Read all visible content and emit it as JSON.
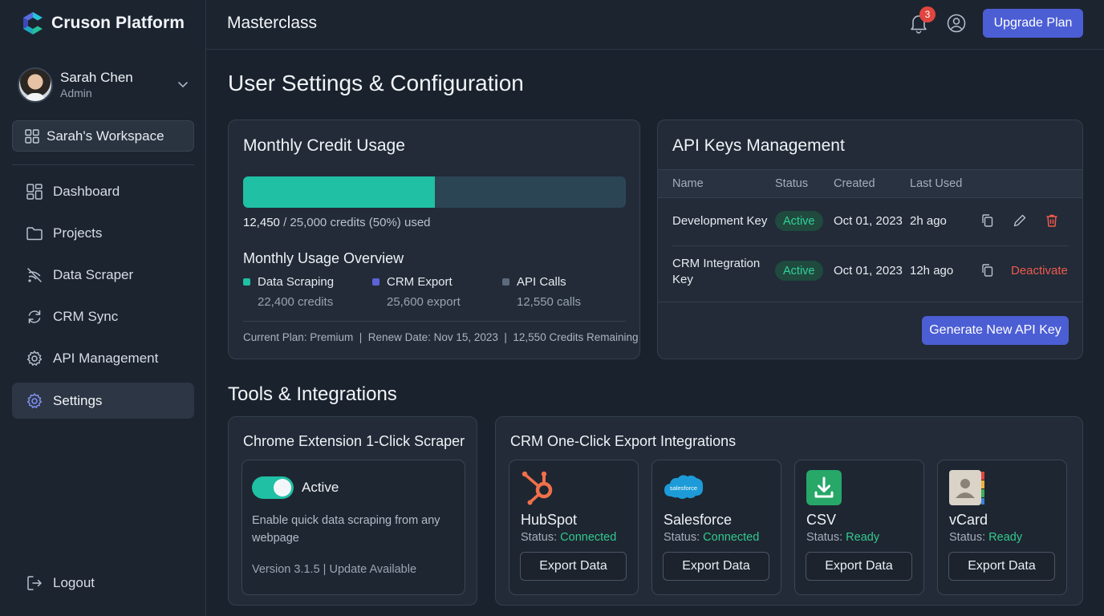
{
  "brand": {
    "name": "Cruson Platform"
  },
  "user": {
    "name": "Sarah Chen",
    "role": "Admin"
  },
  "workspace": {
    "label": "Sarah's Workspace"
  },
  "nav": {
    "items": [
      {
        "label": "Dashboard",
        "icon": "dashboard-icon"
      },
      {
        "label": "Projects",
        "icon": "folder-icon"
      },
      {
        "label": "Data Scraper",
        "icon": "data-scraper-icon"
      },
      {
        "label": "CRM Sync",
        "icon": "sync-icon"
      },
      {
        "label": "API Management",
        "icon": "gear-icon"
      },
      {
        "label": "Settings",
        "icon": "settings-icon",
        "active": true
      }
    ],
    "logout": "Logout"
  },
  "topbar": {
    "title": "Masterclass",
    "notification_count": "3",
    "upgrade_label": "Upgrade Plan"
  },
  "page": {
    "title": "User Settings & Configuration"
  },
  "credits": {
    "title": "Monthly Credit Usage",
    "used_fraction": 0.5,
    "used": "12,450",
    "usage_rest": "/ 25,000 credits (50%) used",
    "overview_title": "Monthly Usage Overview",
    "legend": [
      {
        "label": "Data Scraping",
        "value": "22,400 credits",
        "color": "#1fc0a4"
      },
      {
        "label": "CRM Export",
        "value": "25,600 export",
        "color": "#5b63d6"
      },
      {
        "label": "API Calls",
        "value": "12,550 calls",
        "color": "#5b6a7d"
      }
    ],
    "plan_line": "Current Plan: Premium  |  Renew Date: Nov 15, 2023  |  12,550 Credits Remaining"
  },
  "api_keys": {
    "title": "API Keys Management",
    "columns": [
      "Name",
      "Status",
      "Created",
      "Last Used"
    ],
    "rows": [
      {
        "name": "Development Key",
        "status": "Active",
        "created": "Oct 01, 2023",
        "last_used": "2h ago"
      },
      {
        "name": "CRM Integration Key",
        "status": "Active",
        "created": "Oct 01, 2023",
        "last_used": "12h ago",
        "action": "Deactivate"
      }
    ],
    "generate_label": "Generate New API Key"
  },
  "tools": {
    "title": "Tools & Integrations",
    "extension": {
      "title": "Chrome Extension 1-Click Scraper",
      "toggle_label": "Active",
      "description": "Enable quick data scraping from any webpage",
      "version": "Version 3.1.5 | Update Available"
    },
    "crm": {
      "title": "CRM One-Click Export Integrations",
      "status_prefix": "Status:",
      "items": [
        {
          "name": "HubSpot",
          "status": "Connected",
          "button": "Export Data",
          "logo_text": ""
        },
        {
          "name": "Salesforce",
          "status": "Connected",
          "button": "Export Data",
          "logo_text": "salesforce"
        },
        {
          "name": "CSV",
          "status": "Ready",
          "button": "Export Data",
          "logo_text": ""
        },
        {
          "name": "vCard",
          "status": "Ready",
          "button": "Export Data",
          "logo_text": ""
        }
      ]
    }
  },
  "colors": {
    "accent": "#4c5ed4",
    "teal": "#1fc0a4",
    "success": "#33d19a",
    "danger": "#ef5a4e"
  }
}
